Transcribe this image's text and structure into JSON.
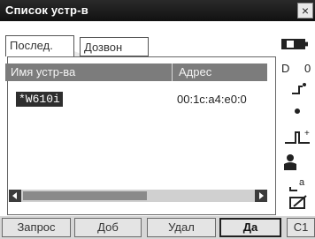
{
  "window": {
    "title": "Список устр-в"
  },
  "tabs": [
    {
      "label": "Послед."
    },
    {
      "label": "Дозвон"
    }
  ],
  "list": {
    "columns": [
      "Имя устр-ва",
      "Адрес"
    ],
    "rows": [
      {
        "name": "*W610i",
        "address": "00:1c:a4:e0:0"
      }
    ]
  },
  "status": {
    "d_label": "D",
    "zero_label": "0",
    "c_label": "C1"
  },
  "buttons": [
    {
      "label": "Запрос"
    },
    {
      "label": "Доб"
    },
    {
      "label": "Удал"
    },
    {
      "label": "Да"
    }
  ]
}
